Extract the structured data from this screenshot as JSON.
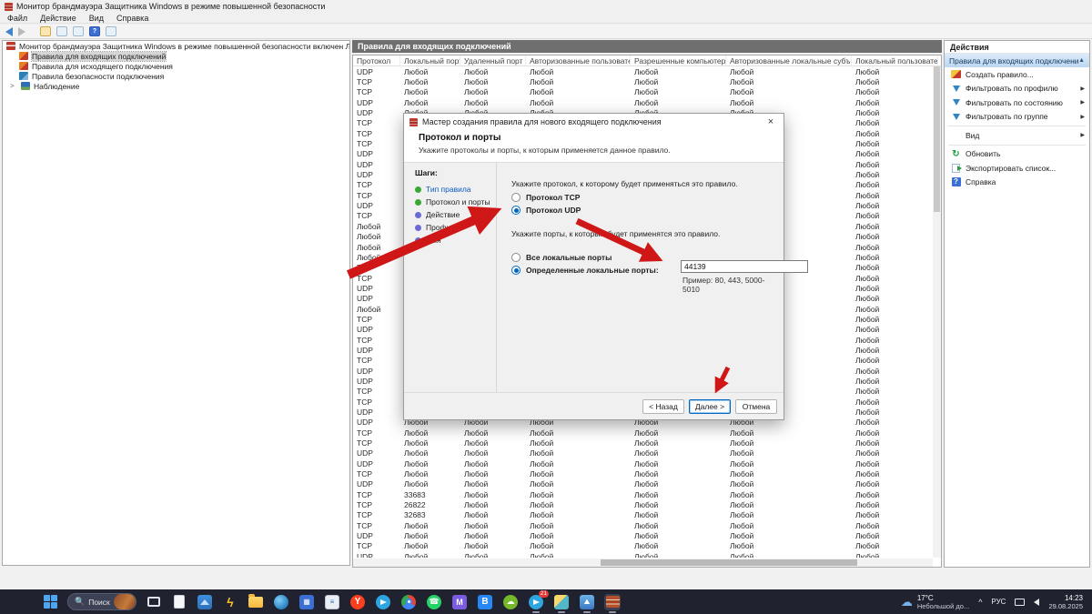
{
  "window": {
    "title": "Монитор брандмауэра Защитника Windows в режиме повышенной безопасности",
    "menu": [
      "Файл",
      "Действие",
      "Вид",
      "Справка"
    ]
  },
  "tree": {
    "root": "Монитор брандмауэра Защитника Windows в режиме повышенной безопасности включен Локальный компьютер",
    "items": [
      {
        "label": "Правила для входящих подключений",
        "selected": true,
        "icon": "inbound-rules-icon"
      },
      {
        "label": "Правила для исходящего подключения",
        "selected": false,
        "icon": "outbound-rules-icon"
      },
      {
        "label": "Правила безопасности подключения",
        "selected": false,
        "icon": "security-rules-icon"
      },
      {
        "label": "Наблюдение",
        "selected": false,
        "icon": "monitoring-icon",
        "expander": true
      }
    ]
  },
  "list": {
    "panel_title": "Правила для входящих подключений",
    "columns": [
      "Протокол",
      "Локальный порт",
      "Удаленный порт",
      "Авторизованные пользователи",
      "Разрешенные компьютеры",
      "Авторизованные локальные субъекты",
      "Локальный пользователь"
    ],
    "default_cell": "Любой",
    "rows": [
      [
        "UDP",
        "Любой"
      ],
      [
        "TCP",
        "Любой"
      ],
      [
        "TCP",
        "Любой"
      ],
      [
        "UDP",
        "Любой"
      ],
      [
        "UDP",
        "Любой"
      ],
      [
        "TCP",
        "Любой"
      ],
      [
        "TCP",
        "Любой"
      ],
      [
        "TCP",
        "Любой"
      ],
      [
        "UDP",
        "Любой"
      ],
      [
        "UDP",
        "Любой"
      ],
      [
        "UDP",
        "Любой"
      ],
      [
        "TCP",
        "Любой"
      ],
      [
        "TCP",
        "Любой"
      ],
      [
        "UDP",
        "Любой"
      ],
      [
        "TCP",
        "Любой"
      ],
      [
        "Любой",
        "Любой"
      ],
      [
        "Любой",
        "Любой"
      ],
      [
        "Любой",
        "Любой"
      ],
      [
        "Любой",
        "Любой"
      ],
      [
        "TCP",
        "Любой"
      ],
      [
        "TCP",
        "Любой"
      ],
      [
        "UDP",
        "Любой"
      ],
      [
        "UDP",
        "Любой"
      ],
      [
        "Любой",
        "Любой"
      ],
      [
        "TCP",
        "Любой"
      ],
      [
        "UDP",
        "Любой"
      ],
      [
        "TCP",
        "Любой"
      ],
      [
        "UDP",
        "Любой"
      ],
      [
        "TCP",
        "Любой"
      ],
      [
        "UDP",
        "Любой"
      ],
      [
        "UDP",
        "Любой"
      ],
      [
        "TCP",
        "Любой"
      ],
      [
        "TCP",
        "Любой"
      ],
      [
        "UDP",
        "Любой"
      ],
      [
        "UDP",
        "Любой"
      ],
      [
        "TCP",
        "Любой"
      ],
      [
        "TCP",
        "Любой"
      ],
      [
        "UDP",
        "Любой"
      ],
      [
        "UDP",
        "Любой"
      ],
      [
        "TCP",
        "Любой"
      ],
      [
        "UDP",
        "Любой"
      ],
      [
        "TCP",
        "33683"
      ],
      [
        "TCP",
        "26822"
      ],
      [
        "TCP",
        "32683"
      ],
      [
        "TCP",
        "Любой"
      ],
      [
        "UDP",
        "Любой"
      ],
      [
        "TCP",
        "Любой"
      ],
      [
        "UDP",
        "Любой"
      ]
    ]
  },
  "actions": {
    "title": "Действия",
    "group_header": "Правила для входящих подключений",
    "collapse_glyph": "▲",
    "submenu_glyph": "▶",
    "items": [
      {
        "label": "Создать правило...",
        "icon": "new-rule-icon",
        "submenu": false,
        "sep_after": false
      },
      {
        "label": "Фильтровать по профилю",
        "icon": "filter-icon",
        "submenu": true,
        "sep_after": false
      },
      {
        "label": "Фильтровать по состоянию",
        "icon": "filter-icon",
        "submenu": true,
        "sep_after": false
      },
      {
        "label": "Фильтровать по группе",
        "icon": "filter-icon",
        "submenu": true,
        "sep_after": true
      },
      {
        "label": "Вид",
        "icon": "none",
        "submenu": true,
        "sep_after": true
      },
      {
        "label": "Обновить",
        "icon": "refresh-icon",
        "submenu": false,
        "sep_after": false
      },
      {
        "label": "Экспортировать список...",
        "icon": "export-icon",
        "submenu": false,
        "sep_after": false
      },
      {
        "label": "Справка",
        "icon": "help-icon",
        "submenu": false,
        "sep_after": false
      }
    ]
  },
  "wizard": {
    "title": "Мастер создания правила для нового входящего подключения",
    "close_label": "×",
    "heading": "Протокол и порты",
    "subtitle": "Укажите протоколы и порты, к которым применяется данное правило.",
    "steps_label": "Шаги:",
    "steps": [
      {
        "label": "Тип правила",
        "state": "done",
        "link": true
      },
      {
        "label": "Протокол и порты",
        "state": "done",
        "link": false
      },
      {
        "label": "Действие",
        "state": "todo",
        "link": false
      },
      {
        "label": "Профиль",
        "state": "todo",
        "link": false
      },
      {
        "label": "Имя",
        "state": "todo",
        "link": false
      }
    ],
    "protocol_prompt": "Укажите протокол, к которому будет применяться это правило.",
    "radio_tcp": "Протокол TCP",
    "radio_udp": "Протокол UDP",
    "ports_prompt": "Укажите порты, к которым будет применятся это правило.",
    "radio_all_ports": "Все локальные порты",
    "radio_specific_ports": "Определенные локальные порты:",
    "ports_value": "44139",
    "ports_example": "Пример: 80, 443, 5000-5010",
    "back_label": "< Назад",
    "next_label": "Далее >",
    "cancel_label": "Отмена"
  },
  "taskbar": {
    "search_placeholder": "Поиск",
    "icons": [
      {
        "name": "start"
      },
      {
        "name": "search"
      },
      {
        "name": "task-view"
      },
      {
        "name": "document"
      },
      {
        "name": "photos"
      },
      {
        "name": "lightning"
      },
      {
        "name": "explorer"
      },
      {
        "name": "browser"
      },
      {
        "name": "calculator"
      },
      {
        "name": "notes"
      },
      {
        "name": "yandex"
      },
      {
        "name": "telegram"
      },
      {
        "name": "chrome"
      },
      {
        "name": "whatsapp"
      },
      {
        "name": "mail"
      },
      {
        "name": "vk"
      },
      {
        "name": "cloud"
      },
      {
        "name": "telegram-2",
        "badge": "21",
        "running": true
      },
      {
        "name": "gallery",
        "running": true
      },
      {
        "name": "photos-2",
        "running": true
      },
      {
        "name": "firewall",
        "running": true,
        "active": true
      }
    ],
    "tray": {
      "temp": "17°C",
      "weather": "Небольшой до...",
      "chevron": "^",
      "lang": "РУС",
      "time": "14:23",
      "date": "29.08.2025"
    }
  }
}
